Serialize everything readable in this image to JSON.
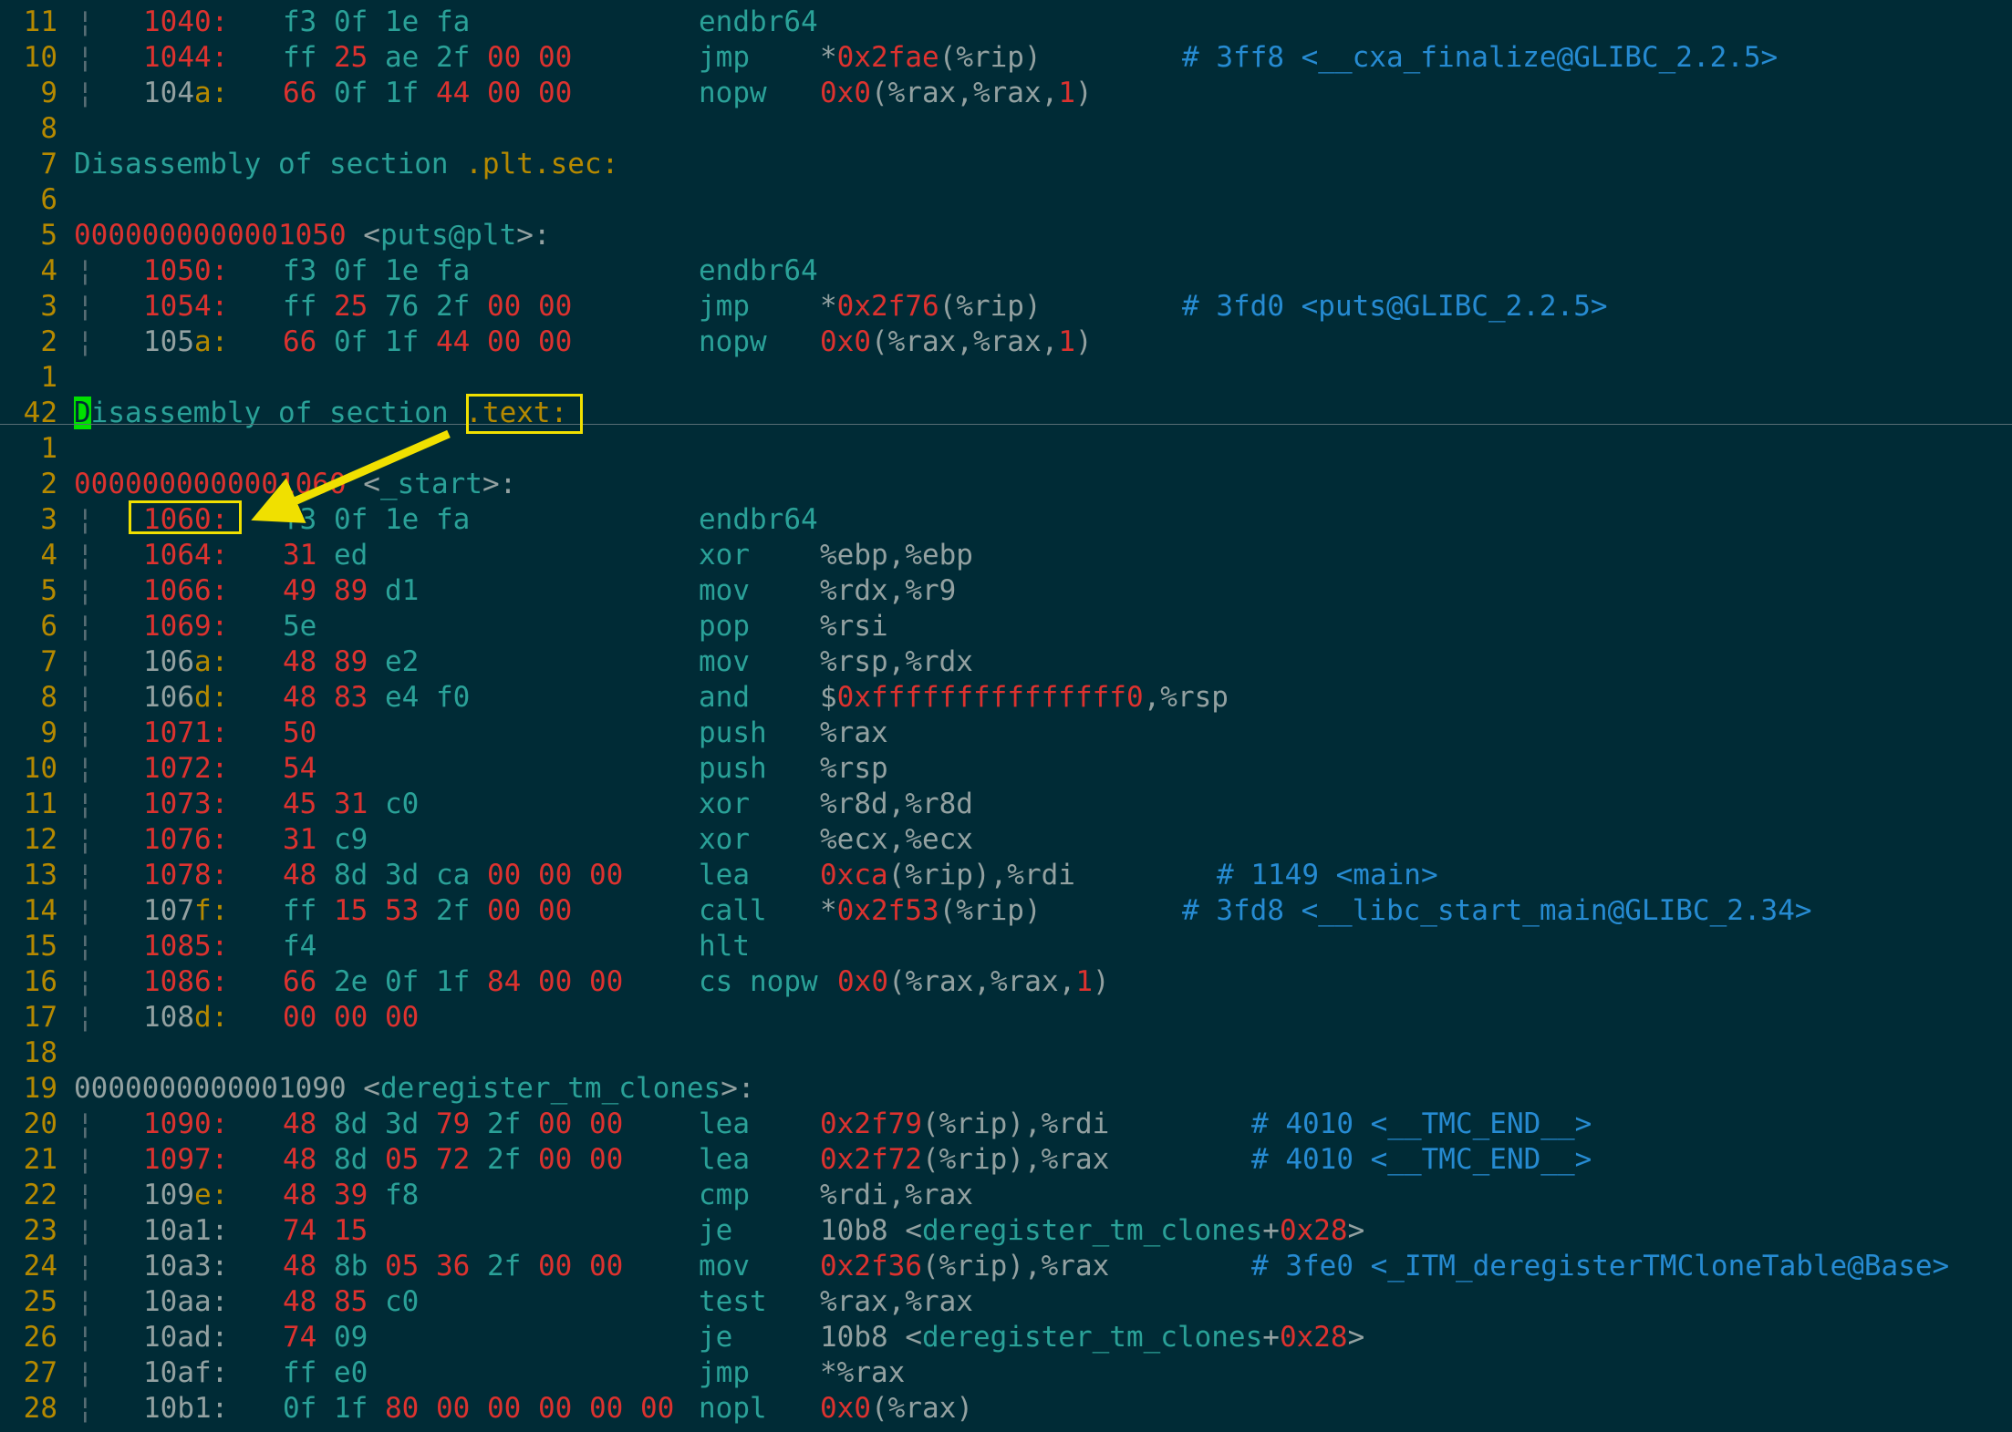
{
  "lines": [
    {
      "ln": "11",
      "kind": "ins",
      "addr": [
        [
          "104",
          "red"
        ],
        [
          "0:",
          "red"
        ]
      ],
      "bytes": [
        [
          "f3",
          "cyan"
        ],
        [
          " 0f",
          "cyan"
        ],
        [
          " 1e",
          "cyan"
        ],
        [
          " fa",
          "cyan"
        ]
      ],
      "mnem": "endbr64",
      "ops": []
    },
    {
      "ln": "10",
      "kind": "ins",
      "addr": [
        [
          "1044:",
          "red"
        ]
      ],
      "bytes": [
        [
          "ff",
          "cyan"
        ],
        [
          " 25",
          "red"
        ],
        [
          " ae",
          "cyan"
        ],
        [
          " 2f",
          "cyan"
        ],
        [
          " 00",
          "red"
        ],
        [
          " 00",
          "red"
        ]
      ],
      "mnem": "jmp",
      "ops": [
        [
          "*",
          "gray"
        ],
        [
          "0x2fae",
          "red"
        ],
        [
          "(%rip)",
          "gray"
        ]
      ],
      "cmt": "# 3ff8 <__cxa_finalize@GLIBC_2.2.5>",
      "cmtx": 1296
    },
    {
      "ln": "9",
      "kind": "ins",
      "addr": [
        [
          "104",
          "gray"
        ],
        [
          "a:",
          "yel"
        ]
      ],
      "bytes": [
        [
          "66",
          "red"
        ],
        [
          " 0f",
          "cyan"
        ],
        [
          " 1f",
          "cyan"
        ],
        [
          " 44",
          "red"
        ],
        [
          " 00",
          "red"
        ],
        [
          " 00",
          "red"
        ]
      ],
      "mnem": "nopw",
      "ops": [
        [
          "0x0",
          "red"
        ],
        [
          "(%rax,%rax,",
          "gray"
        ],
        [
          "1",
          "red"
        ],
        [
          ")",
          "gray"
        ]
      ]
    },
    {
      "ln": "8",
      "kind": "blank"
    },
    {
      "ln": "7",
      "kind": "sec",
      "text": "Disassembly of section ",
      "name": ".plt.sec:"
    },
    {
      "ln": "6",
      "kind": "blank"
    },
    {
      "ln": "5",
      "kind": "hdr",
      "addr": "0000000000001050",
      "label": " <puts@plt>:"
    },
    {
      "ln": "4",
      "kind": "ins",
      "addr": [
        [
          "1050:",
          "red"
        ]
      ],
      "bytes": [
        [
          "f3",
          "cyan"
        ],
        [
          " 0f",
          "cyan"
        ],
        [
          " 1e",
          "cyan"
        ],
        [
          " fa",
          "cyan"
        ]
      ],
      "mnem": "endbr64",
      "ops": []
    },
    {
      "ln": "3",
      "kind": "ins",
      "addr": [
        [
          "1054:",
          "red"
        ]
      ],
      "bytes": [
        [
          "ff",
          "cyan"
        ],
        [
          " 25",
          "red"
        ],
        [
          " 76",
          "cyan"
        ],
        [
          " 2f",
          "cyan"
        ],
        [
          " 00",
          "red"
        ],
        [
          " 00",
          "red"
        ]
      ],
      "mnem": "jmp",
      "ops": [
        [
          "*",
          "gray"
        ],
        [
          "0x2f76",
          "red"
        ],
        [
          "(%rip)",
          "gray"
        ]
      ],
      "cmt": "# 3fd0 <puts@GLIBC_2.2.5>",
      "cmtx": 1296
    },
    {
      "ln": "2",
      "kind": "ins",
      "addr": [
        [
          "105",
          "gray"
        ],
        [
          "a:",
          "yel"
        ]
      ],
      "bytes": [
        [
          "66",
          "red"
        ],
        [
          " 0f",
          "cyan"
        ],
        [
          " 1f",
          "cyan"
        ],
        [
          " 44",
          "red"
        ],
        [
          " 00",
          "red"
        ],
        [
          " 00",
          "red"
        ]
      ],
      "mnem": "nopw",
      "ops": [
        [
          "0x0",
          "red"
        ],
        [
          "(%rax,%rax,",
          "gray"
        ],
        [
          "1",
          "red"
        ],
        [
          ")",
          "gray"
        ]
      ]
    },
    {
      "ln": "1",
      "kind": "blank"
    },
    {
      "ln": "42",
      "kind": "cursec",
      "text": "isassembly of section ",
      "cur": "D",
      "name": ".text:"
    },
    {
      "ln": "1",
      "kind": "blank"
    },
    {
      "ln": "2",
      "kind": "hdr",
      "addr": "0000000000001060",
      "label": " <_start>:"
    },
    {
      "ln": "3",
      "kind": "ins",
      "addr": [
        [
          "1060:",
          "red"
        ]
      ],
      "bytes": [
        [
          "f3",
          "cyan"
        ],
        [
          " 0f",
          "cyan"
        ],
        [
          " 1e",
          "cyan"
        ],
        [
          " fa",
          "cyan"
        ]
      ],
      "mnem": "endbr64",
      "ops": []
    },
    {
      "ln": "4",
      "kind": "ins",
      "addr": [
        [
          "1064:",
          "red"
        ]
      ],
      "bytes": [
        [
          "31",
          "red"
        ],
        [
          " ed",
          "cyan"
        ]
      ],
      "mnem": "xor",
      "ops": [
        [
          "%ebp,%ebp",
          "gray"
        ]
      ]
    },
    {
      "ln": "5",
      "kind": "ins",
      "addr": [
        [
          "1066:",
          "red"
        ]
      ],
      "bytes": [
        [
          "49",
          "red"
        ],
        [
          " 89",
          "red"
        ],
        [
          " d1",
          "cyan"
        ]
      ],
      "mnem": "mov",
      "ops": [
        [
          "%rdx,%r9",
          "gray"
        ]
      ]
    },
    {
      "ln": "6",
      "kind": "ins",
      "addr": [
        [
          "1069:",
          "red"
        ]
      ],
      "bytes": [
        [
          "5e",
          "cyan"
        ]
      ],
      "mnem": "pop",
      "ops": [
        [
          "%rsi",
          "gray"
        ]
      ]
    },
    {
      "ln": "7",
      "kind": "ins",
      "addr": [
        [
          "106",
          "gray"
        ],
        [
          "a:",
          "yel"
        ]
      ],
      "bytes": [
        [
          "48",
          "red"
        ],
        [
          " 89",
          "red"
        ],
        [
          " e2",
          "cyan"
        ]
      ],
      "mnem": "mov",
      "ops": [
        [
          "%rsp,%rdx",
          "gray"
        ]
      ]
    },
    {
      "ln": "8",
      "kind": "ins",
      "addr": [
        [
          "106",
          "gray"
        ],
        [
          "d:",
          "yel"
        ]
      ],
      "bytes": [
        [
          "48",
          "red"
        ],
        [
          " 83",
          "red"
        ],
        [
          " e4",
          "cyan"
        ],
        [
          " f0",
          "cyan"
        ]
      ],
      "mnem": "and",
      "ops": [
        [
          "$",
          "gray"
        ],
        [
          "0xfffffffffffffff0",
          "red"
        ],
        [
          ",%rsp",
          "gray"
        ]
      ]
    },
    {
      "ln": "9",
      "kind": "ins",
      "addr": [
        [
          "1071:",
          "red"
        ]
      ],
      "bytes": [
        [
          "50",
          "red"
        ]
      ],
      "mnem": "push",
      "ops": [
        [
          "%rax",
          "gray"
        ]
      ]
    },
    {
      "ln": "10",
      "kind": "ins",
      "addr": [
        [
          "1072:",
          "red"
        ]
      ],
      "bytes": [
        [
          "54",
          "red"
        ]
      ],
      "mnem": "push",
      "ops": [
        [
          "%rsp",
          "gray"
        ]
      ]
    },
    {
      "ln": "11",
      "kind": "ins",
      "addr": [
        [
          "1073:",
          "red"
        ]
      ],
      "bytes": [
        [
          "45",
          "red"
        ],
        [
          " 31",
          "red"
        ],
        [
          " c0",
          "cyan"
        ]
      ],
      "mnem": "xor",
      "ops": [
        [
          "%r8d,%r8d",
          "gray"
        ]
      ]
    },
    {
      "ln": "12",
      "kind": "ins",
      "addr": [
        [
          "1076:",
          "red"
        ]
      ],
      "bytes": [
        [
          "31",
          "red"
        ],
        [
          " c9",
          "cyan"
        ]
      ],
      "mnem": "xor",
      "ops": [
        [
          "%ecx,%ecx",
          "gray"
        ]
      ]
    },
    {
      "ln": "13",
      "kind": "ins",
      "addr": [
        [
          "1078:",
          "red"
        ]
      ],
      "bytes": [
        [
          "48",
          "red"
        ],
        [
          " 8d",
          "cyan"
        ],
        [
          " 3d",
          "cyan"
        ],
        [
          " ca",
          "cyan"
        ],
        [
          " 00",
          "red"
        ],
        [
          " 00",
          "red"
        ],
        [
          " 00",
          "red"
        ]
      ],
      "mnem": "lea",
      "ops": [
        [
          "0xca",
          "red"
        ],
        [
          "(%rip),%rdi",
          "gray"
        ]
      ],
      "cmt": "# 1149 <main>",
      "cmtx": 1334
    },
    {
      "ln": "14",
      "kind": "ins",
      "addr": [
        [
          "107",
          "gray"
        ],
        [
          "f:",
          "yel"
        ]
      ],
      "bytes": [
        [
          "ff",
          "cyan"
        ],
        [
          " 15",
          "red"
        ],
        [
          " 53",
          "red"
        ],
        [
          " 2f",
          "cyan"
        ],
        [
          " 00",
          "red"
        ],
        [
          " 00",
          "red"
        ]
      ],
      "mnem": "call",
      "ops": [
        [
          "*",
          "gray"
        ],
        [
          "0x2f53",
          "red"
        ],
        [
          "(%rip)",
          "gray"
        ]
      ],
      "cmt": "# 3fd8 <__libc_start_main@GLIBC_2.34>",
      "cmtx": 1296
    },
    {
      "ln": "15",
      "kind": "ins",
      "addr": [
        [
          "1085:",
          "red"
        ]
      ],
      "bytes": [
        [
          "f4",
          "cyan"
        ]
      ],
      "mnem": "hlt",
      "ops": []
    },
    {
      "ln": "16",
      "kind": "ins",
      "addr": [
        [
          "1086:",
          "red"
        ]
      ],
      "bytes": [
        [
          "66",
          "red"
        ],
        [
          " 2e",
          "cyan"
        ],
        [
          " 0f",
          "cyan"
        ],
        [
          " 1f",
          "cyan"
        ],
        [
          " 84",
          "red"
        ],
        [
          " 00",
          "red"
        ],
        [
          " 00",
          "red"
        ]
      ],
      "mnem": "cs nopw",
      "ops": [
        [
          "0x0",
          "red"
        ],
        [
          "(%rax,%rax,",
          "gray"
        ],
        [
          "1",
          "red"
        ],
        [
          ")",
          "gray"
        ]
      ],
      "opsx": 918
    },
    {
      "ln": "17",
      "kind": "ins",
      "addr": [
        [
          "108",
          "gray"
        ],
        [
          "d:",
          "yel"
        ]
      ],
      "bytes": [
        [
          "00",
          "red"
        ],
        [
          " 00",
          "red"
        ],
        [
          " 00",
          "red"
        ]
      ],
      "mnem": "",
      "ops": []
    },
    {
      "ln": "18",
      "kind": "blank"
    },
    {
      "ln": "19",
      "kind": "hdr",
      "addr": "0000000000001090",
      "label": " <deregister_tm_clones>:",
      "addrcolor": "gray"
    },
    {
      "ln": "20",
      "kind": "ins",
      "addr": [
        [
          "1090:",
          "red"
        ]
      ],
      "bytes": [
        [
          "48",
          "red"
        ],
        [
          " 8d",
          "cyan"
        ],
        [
          " 3d",
          "cyan"
        ],
        [
          " 79",
          "red"
        ],
        [
          " 2f",
          "cyan"
        ],
        [
          " 00",
          "red"
        ],
        [
          " 00",
          "red"
        ]
      ],
      "mnem": "lea",
      "ops": [
        [
          "0x2f79",
          "red"
        ],
        [
          "(%rip),%rdi",
          "gray"
        ]
      ],
      "cmt": "# 4010 <__TMC_END__>",
      "cmtx": 1372
    },
    {
      "ln": "21",
      "kind": "ins",
      "addr": [
        [
          "1097:",
          "red"
        ]
      ],
      "bytes": [
        [
          "48",
          "red"
        ],
        [
          " 8d",
          "cyan"
        ],
        [
          " 05",
          "red"
        ],
        [
          " 72",
          "red"
        ],
        [
          " 2f",
          "cyan"
        ],
        [
          " 00",
          "red"
        ],
        [
          " 00",
          "red"
        ]
      ],
      "mnem": "lea",
      "ops": [
        [
          "0x2f72",
          "red"
        ],
        [
          "(%rip),%rax",
          "gray"
        ]
      ],
      "cmt": "# 4010 <__TMC_END__>",
      "cmtx": 1372
    },
    {
      "ln": "22",
      "kind": "ins",
      "addr": [
        [
          "109",
          "gray"
        ],
        [
          "e:",
          "yel"
        ]
      ],
      "bytes": [
        [
          "48",
          "red"
        ],
        [
          " 39",
          "red"
        ],
        [
          " f8",
          "cyan"
        ]
      ],
      "mnem": "cmp",
      "ops": [
        [
          "%rdi,%rax",
          "gray"
        ]
      ]
    },
    {
      "ln": "23",
      "kind": "ins",
      "addr": [
        [
          "10a1:",
          "gray"
        ]
      ],
      "bytes": [
        [
          "74",
          "red"
        ],
        [
          " 15",
          "red"
        ]
      ],
      "mnem": "je",
      "ops": [
        [
          "10b8 <",
          "gray"
        ],
        [
          "deregister_tm_clones",
          "cyan"
        ],
        [
          "+",
          "gray"
        ],
        [
          "0x28",
          "red"
        ],
        [
          ">",
          "gray"
        ]
      ]
    },
    {
      "ln": "24",
      "kind": "ins",
      "addr": [
        [
          "10a3:",
          "gray"
        ]
      ],
      "bytes": [
        [
          "48",
          "red"
        ],
        [
          " 8b",
          "cyan"
        ],
        [
          " 05",
          "red"
        ],
        [
          " 36",
          "red"
        ],
        [
          " 2f",
          "cyan"
        ],
        [
          " 00",
          "red"
        ],
        [
          " 00",
          "red"
        ]
      ],
      "mnem": "mov",
      "ops": [
        [
          "0x2f36",
          "red"
        ],
        [
          "(%rip),%rax",
          "gray"
        ]
      ],
      "cmt": "# 3fe0 <_ITM_deregisterTMCloneTable@Base>",
      "cmtx": 1372
    },
    {
      "ln": "25",
      "kind": "ins",
      "addr": [
        [
          "10aa:",
          "gray"
        ]
      ],
      "bytes": [
        [
          "48",
          "red"
        ],
        [
          " 85",
          "red"
        ],
        [
          " c0",
          "cyan"
        ]
      ],
      "mnem": "test",
      "ops": [
        [
          "%rax,%rax",
          "gray"
        ]
      ]
    },
    {
      "ln": "26",
      "kind": "ins",
      "addr": [
        [
          "10ad:",
          "gray"
        ]
      ],
      "bytes": [
        [
          "74",
          "red"
        ],
        [
          " 09",
          "cyan"
        ]
      ],
      "mnem": "je",
      "ops": [
        [
          "10b8 <",
          "gray"
        ],
        [
          "deregister_tm_clones",
          "cyan"
        ],
        [
          "+",
          "gray"
        ],
        [
          "0x28",
          "red"
        ],
        [
          ">",
          "gray"
        ]
      ]
    },
    {
      "ln": "27",
      "kind": "ins",
      "addr": [
        [
          "10af:",
          "gray"
        ]
      ],
      "bytes": [
        [
          "ff",
          "cyan"
        ],
        [
          " e0",
          "cyan"
        ]
      ],
      "mnem": "jmp",
      "ops": [
        [
          "*%rax",
          "gray"
        ]
      ]
    },
    {
      "ln": "28",
      "kind": "ins",
      "addr": [
        [
          "10b1:",
          "gray"
        ]
      ],
      "bytes": [
        [
          "0f",
          "cyan"
        ],
        [
          " 1f",
          "cyan"
        ],
        [
          " 80",
          "red"
        ],
        [
          " 00",
          "red"
        ],
        [
          " 00",
          "red"
        ],
        [
          " 00",
          "red"
        ],
        [
          " 00",
          "red"
        ],
        [
          " 00",
          "red"
        ]
      ],
      "mnem": "nopl",
      "ops": [
        [
          "0x0",
          "red"
        ],
        [
          "(%rax)",
          "gray"
        ]
      ]
    }
  ],
  "colors": {
    "background": "#002b36",
    "highlight_box": "#f0e000",
    "cursor": "#00e000"
  }
}
